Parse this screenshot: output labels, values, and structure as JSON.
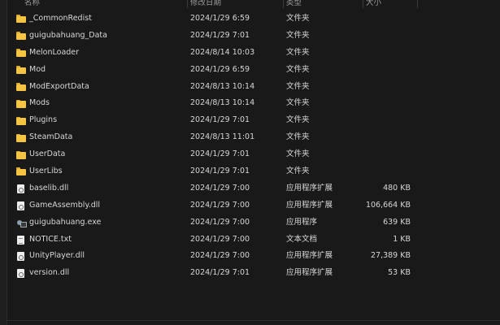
{
  "columns": {
    "name": "名称",
    "date": "修改日期",
    "type": "类型",
    "size": "大小"
  },
  "files": [
    {
      "name": "_CommonRedist",
      "date": "2024/1/29 6:59",
      "type": "文件夹",
      "size": "",
      "icon": "folder"
    },
    {
      "name": "guigubahuang_Data",
      "date": "2024/1/29 7:01",
      "type": "文件夹",
      "size": "",
      "icon": "folder"
    },
    {
      "name": "MelonLoader",
      "date": "2024/8/14 10:03",
      "type": "文件夹",
      "size": "",
      "icon": "folder"
    },
    {
      "name": "Mod",
      "date": "2024/1/29 6:59",
      "type": "文件夹",
      "size": "",
      "icon": "folder"
    },
    {
      "name": "ModExportData",
      "date": "2024/8/13 10:14",
      "type": "文件夹",
      "size": "",
      "icon": "folder"
    },
    {
      "name": "Mods",
      "date": "2024/8/13 10:14",
      "type": "文件夹",
      "size": "",
      "icon": "folder"
    },
    {
      "name": "Plugins",
      "date": "2024/1/29 7:01",
      "type": "文件夹",
      "size": "",
      "icon": "folder"
    },
    {
      "name": "SteamData",
      "date": "2024/8/13 11:01",
      "type": "文件夹",
      "size": "",
      "icon": "folder"
    },
    {
      "name": "UserData",
      "date": "2024/1/29 7:01",
      "type": "文件夹",
      "size": "",
      "icon": "folder"
    },
    {
      "name": "UserLibs",
      "date": "2024/1/29 7:01",
      "type": "文件夹",
      "size": "",
      "icon": "folder"
    },
    {
      "name": "baselib.dll",
      "date": "2024/1/29 7:00",
      "type": "应用程序扩展",
      "size": "480 KB",
      "icon": "dll"
    },
    {
      "name": "GameAssembly.dll",
      "date": "2024/1/29 7:00",
      "type": "应用程序扩展",
      "size": "106,664 KB",
      "icon": "dll"
    },
    {
      "name": "guigubahuang.exe",
      "date": "2024/1/29 7:00",
      "type": "应用程序",
      "size": "639 KB",
      "icon": "exe"
    },
    {
      "name": "NOTICE.txt",
      "date": "2024/1/29 7:00",
      "type": "文本文档",
      "size": "1 KB",
      "icon": "txt"
    },
    {
      "name": "UnityPlayer.dll",
      "date": "2024/1/29 7:00",
      "type": "应用程序扩展",
      "size": "27,389 KB",
      "icon": "dll"
    },
    {
      "name": "version.dll",
      "date": "2024/1/29 7:01",
      "type": "应用程序扩展",
      "size": "53 KB",
      "icon": "dll"
    }
  ]
}
